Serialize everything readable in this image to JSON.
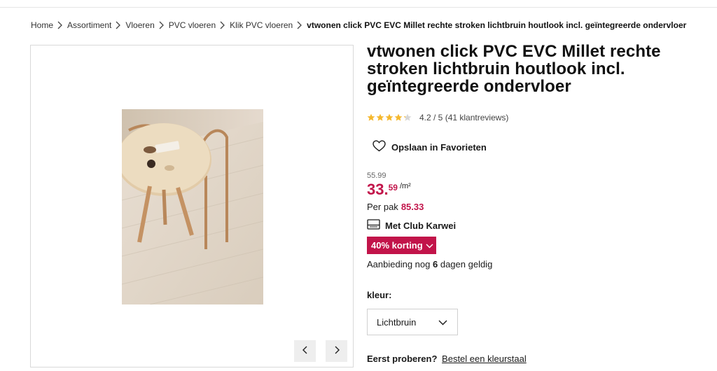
{
  "breadcrumb": {
    "items": [
      "Home",
      "Assortiment",
      "Vloeren",
      "PVC vloeren",
      "Klik PVC vloeren"
    ],
    "current": "vtwonen click PVC EVC Millet rechte stroken lichtbruin houtlook incl. geïntegreerde ondervloer"
  },
  "product": {
    "title": "vtwonen click PVC EVC Millet rechte stroken lichtbruin houtlook incl. geïntegreerde ondervloer",
    "rating_value": 4.2,
    "rating_text": "4.2 / 5",
    "reviews_text": "(41 klantreviews)",
    "favorite_label": "Opslaan in Favorieten",
    "old_price": "55.99",
    "price_integer": "33.",
    "price_decimal": "59",
    "price_unit": "/m²",
    "per_pak_label": "Per pak",
    "per_pak_value": "85.33",
    "club_label": "Met Club Karwei",
    "discount_label": "40% korting",
    "offer_prefix": "Aanbieding nog",
    "offer_days": "6",
    "offer_suffix": "dagen geldig",
    "color_label": "kleur:",
    "color_selected": "Lichtbruin",
    "try_label": "Eerst proberen?",
    "try_link": "Bestel een kleurstaal"
  },
  "gallery": {
    "prev_icon": "chevron-left-icon",
    "next_icon": "chevron-right-icon"
  },
  "colors": {
    "accent": "#c2144a",
    "star": "#f5b82e",
    "star_empty": "#d6d6d6"
  }
}
